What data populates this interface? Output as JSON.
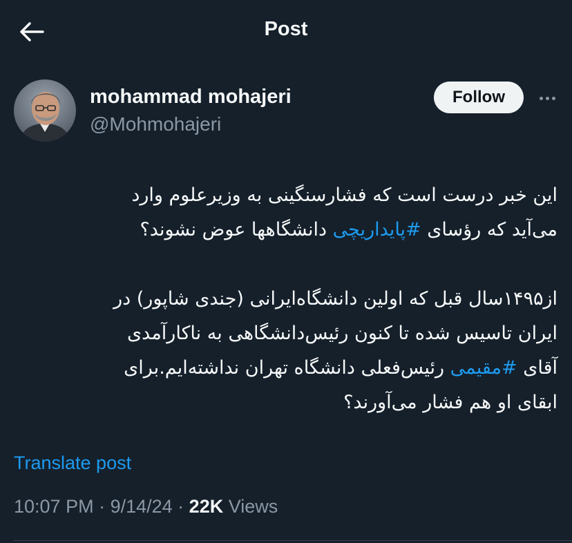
{
  "header": {
    "title": "Post",
    "back_icon": "arrow-left-icon"
  },
  "author": {
    "name": "mohammad mohajeri",
    "handle": "@Mohmohajeri",
    "follow_label": "Follow",
    "more_icon": "more-horizontal-icon"
  },
  "tweet": {
    "p1_line1": "این خبر درست است که فشارسنگینی به وزیرعلوم وارد",
    "p1_line2_before": "می‌آید که رؤسای ",
    "p1_hashtag": "#پایداریچی",
    "p1_line2_after": " دانشگاهها عوض نشوند؟",
    "p2_line1": "از۱۴۹۵سال قبل که اولین دانشگاه‌ایرانی (جندی شاپور) در",
    "p2_line2": "ایران تاسیس شده تا کنون رئیس‌دانشگاهی به ناکارآمدی",
    "p2_line3_before": "آقای ",
    "p2_hashtag": "#مقیمی",
    "p2_line3_after": " رئیس‌فعلی دانشگاه تهران نداشته‌ایم.برای",
    "p2_line4": "ابقای او هم فشار می‌آورند؟"
  },
  "translate_label": "Translate post",
  "meta": {
    "time": "10:07 PM",
    "sep1": " · ",
    "date": "9/14/24",
    "sep2": " · ",
    "views_count": "22K",
    "views_label": " Views"
  },
  "colors": {
    "background": "#15202b",
    "accent": "#1d9bf0",
    "muted": "#8b98a5",
    "follow_bg": "#eff3f4"
  }
}
